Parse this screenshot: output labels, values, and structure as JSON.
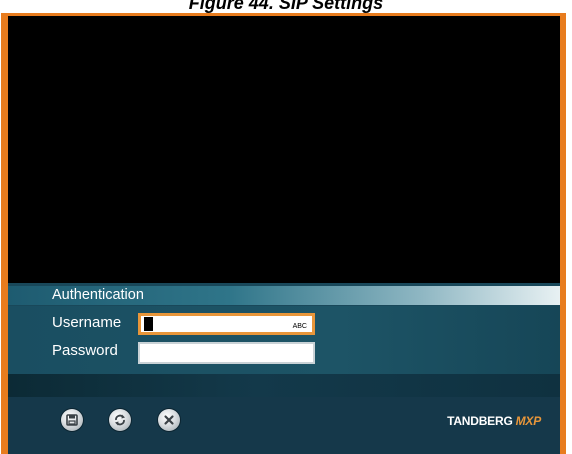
{
  "figure_caption": "Figure 44. SIP Settings",
  "panel": {
    "header": "Authentication",
    "username": {
      "label": "Username",
      "value": "",
      "input_mode": "ABC"
    },
    "password": {
      "label": "Password",
      "value": ""
    }
  },
  "toolbar": {
    "save_icon": "floppy-disk-icon",
    "refresh_icon": "refresh-icon",
    "close_icon": "close-icon"
  },
  "brand": {
    "name": "TANDBERG",
    "suffix": "MXP"
  },
  "colors": {
    "frame": "#e87c1e",
    "panel": "#19485a",
    "toolbar": "#15384a",
    "active_field_border": "#e8963a"
  }
}
